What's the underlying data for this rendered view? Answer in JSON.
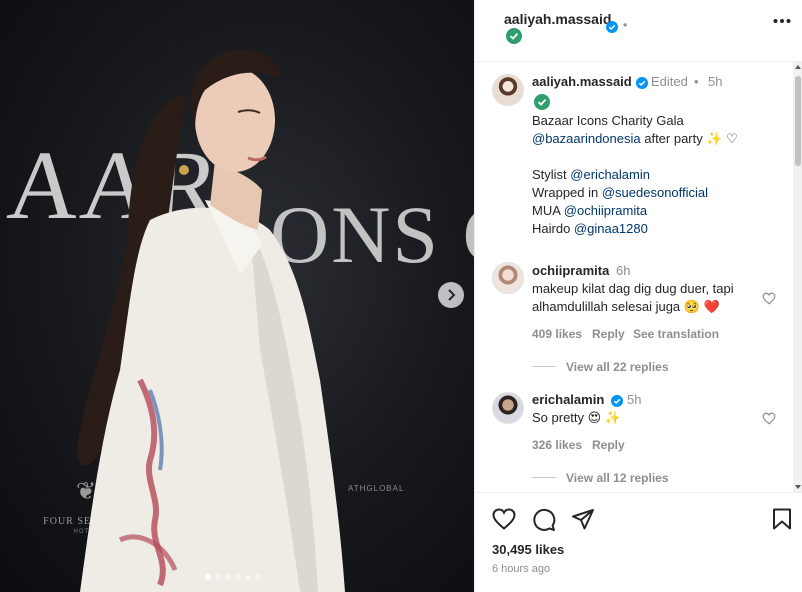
{
  "photo": {
    "backdrop_line1": "AAR",
    "backdrop_line2": "ONS C",
    "sponsor_logo_name": "FOUR SEASONS",
    "sponsor_logo_sub": "HOTEL",
    "carousel_count": 6,
    "carousel_active": 0
  },
  "header": {
    "username": "aaliyah.massaid",
    "separator": "•"
  },
  "caption": {
    "username": "aaliyah.massaid",
    "edited": "Edited",
    "dot": "•",
    "time": "5h",
    "line1": "Bazaar Icons Charity Gala",
    "mention1": "@bazaarindonesia",
    "line2_rest": " after party ✨ ♡",
    "stylist_label": "Stylist ",
    "stylist": "@erichalamin",
    "wrapped_label": "Wrapped in ",
    "wrapped": "@suedesonofficial",
    "mua_label": "MUA ",
    "mua": "@ochiipramita",
    "hairdo_label": "Hairdo ",
    "hairdo": "@ginaa1280"
  },
  "comments": [
    {
      "username": "ochiipramita",
      "time": "6h",
      "line1": "makeup kilat dag dig dug duer, tapi",
      "line2": "alhamdulillah selesai juga 🥺 ❤️",
      "likes": "409 likes",
      "reply": "Reply",
      "translate": "See translation",
      "view_replies": "View all 22 replies"
    },
    {
      "username": "erichalamin",
      "time": "5h",
      "text": "So pretty 😍 ✨",
      "likes": "326 likes",
      "reply": "Reply",
      "view_replies": "View all 12 replies"
    }
  ],
  "footer": {
    "likes": "30,495 likes",
    "time_ago": "6 hours ago"
  },
  "colors": {
    "verified": "#0095f6",
    "badge_green": "#2f9e6e",
    "link": "#00376b",
    "muted": "#8e8e8e",
    "red_heart": "#ed4956"
  },
  "icons": {
    "like": "heart-outline-icon",
    "comment": "speech-bubble-icon",
    "share": "paper-plane-icon",
    "save": "bookmark-icon",
    "more": "ellipsis-icon",
    "verified": "verified-badge-icon",
    "next": "chevron-right-icon"
  }
}
